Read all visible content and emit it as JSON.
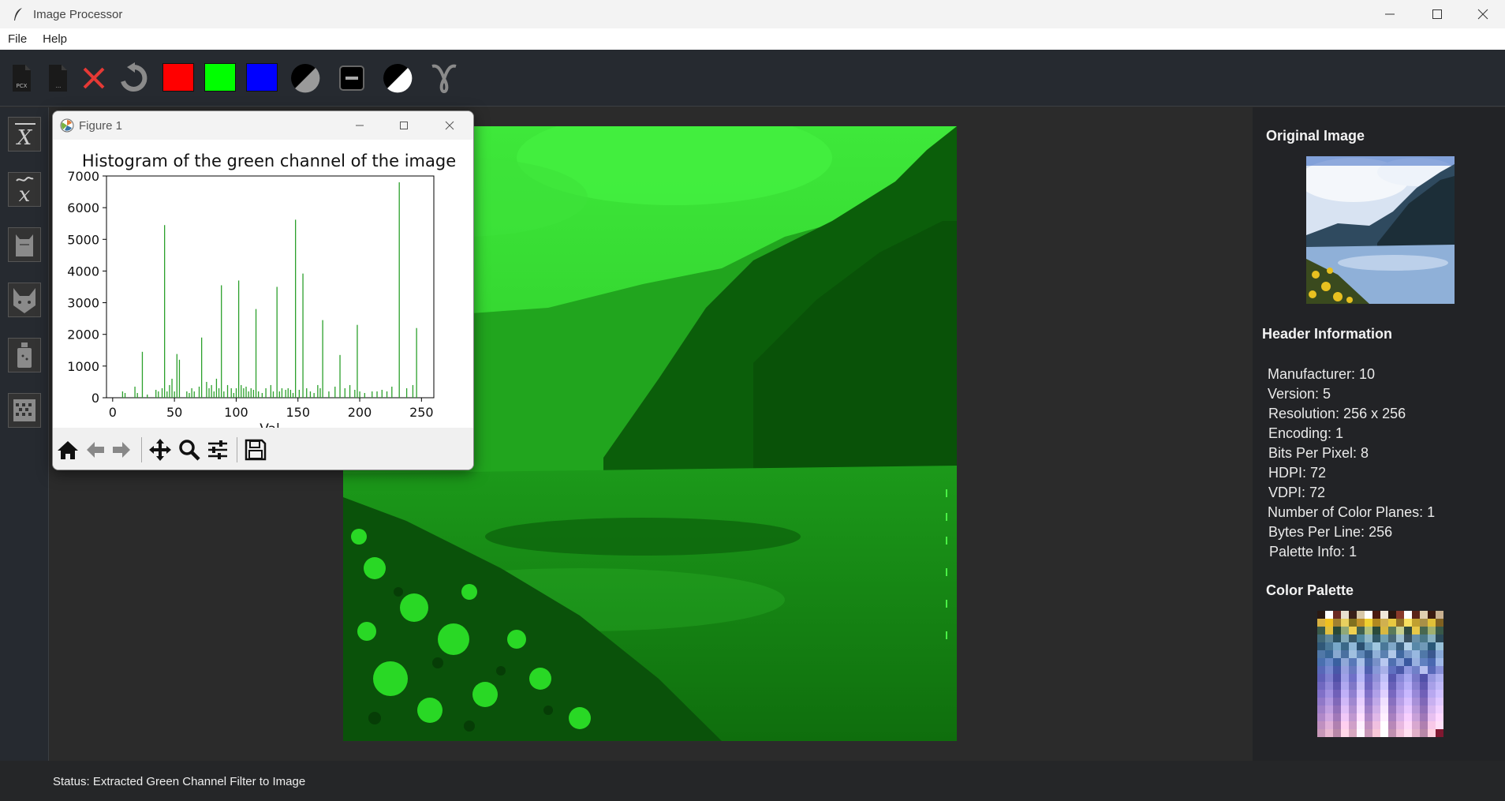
{
  "window": {
    "title": "Image Processor"
  },
  "menu": {
    "file": "File",
    "help": "Help"
  },
  "toolbar": {
    "pcx_label": "PCX",
    "swatches": {
      "red": "#ff0000",
      "green": "#00ff00",
      "blue": "#0000ff"
    }
  },
  "figure": {
    "title": "Figure 1",
    "chart_data": {
      "type": "bar",
      "title": "Histogram of the green channel of the image",
      "xlabel": "Val",
      "ylabel": "",
      "xlim": [
        -5,
        260
      ],
      "ylim": [
        0,
        7000
      ],
      "xticks": [
        "0",
        "50",
        "100",
        "150",
        "200",
        "250"
      ],
      "yticks": [
        "0",
        "1000",
        "2000",
        "3000",
        "4000",
        "5000",
        "6000",
        "7000"
      ],
      "color": "#2ca02c",
      "x": [
        8,
        10,
        18,
        20,
        24,
        28,
        35,
        37,
        40,
        42,
        44,
        46,
        48,
        50,
        52,
        54,
        60,
        62,
        64,
        66,
        70,
        72,
        76,
        78,
        80,
        82,
        84,
        86,
        88,
        90,
        93,
        96,
        98,
        100,
        102,
        104,
        106,
        108,
        110,
        112,
        114,
        116,
        118,
        121,
        124,
        128,
        130,
        133,
        135,
        137,
        140,
        142,
        144,
        146,
        148,
        151,
        154,
        157,
        160,
        163,
        166,
        168,
        170,
        175,
        180,
        184,
        188,
        192,
        196,
        198,
        200,
        204,
        210,
        214,
        218,
        222,
        226,
        232,
        238,
        243,
        246
      ],
      "values": [
        200,
        150,
        350,
        150,
        1450,
        100,
        250,
        200,
        300,
        5450,
        200,
        400,
        600,
        200,
        1380,
        1200,
        200,
        150,
        300,
        200,
        350,
        1900,
        500,
        300,
        400,
        200,
        600,
        300,
        3550,
        200,
        400,
        300,
        150,
        300,
        3700,
        400,
        300,
        350,
        200,
        300,
        250,
        2800,
        200,
        150,
        300,
        400,
        200,
        3500,
        200,
        300,
        250,
        300,
        250,
        150,
        5620,
        250,
        3920,
        300,
        200,
        150,
        400,
        300,
        2450,
        200,
        350,
        1350,
        300,
        400,
        250,
        2300,
        200,
        150,
        200,
        200,
        250,
        200,
        350,
        6800,
        300,
        400,
        2200
      ]
    }
  },
  "panel": {
    "original_title": "Original Image",
    "header_title": "Header Information",
    "header_lines": [
      "Manufacturer: 10",
      "Version: 5",
      "Resolution: 256 x 256",
      "Encoding: 1",
      "Bits Per Pixel: 8",
      "HDPI: 72",
      "VDPI: 72",
      "Number of Color Planes: 1",
      "Bytes Per Line: 256",
      "Palette Info: 1"
    ],
    "palette_title": "Color Palette"
  },
  "status": {
    "text": "Status: Extracted Green Channel Filter to Image"
  }
}
